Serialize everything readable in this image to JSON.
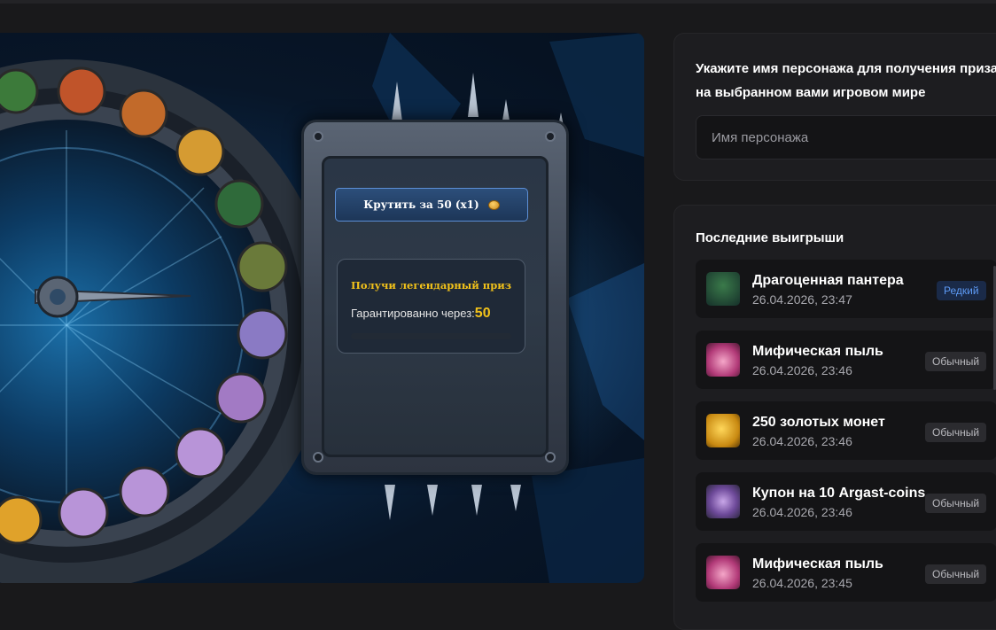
{
  "game": {
    "spin_button": "Крутить за 50 (x1)",
    "legend_title": "Получи легендарный приз",
    "guarantee_label": "Гарантированно через:",
    "guarantee_count": "50",
    "progress_fraction": 0
  },
  "name_form": {
    "title": "Укажите имя персонажа для получения приза на выбранном вами игровом мире",
    "placeholder": "Имя персонажа"
  },
  "wins": {
    "title": "Последние выигрыши",
    "items": [
      {
        "name": "Драгоценная пантера",
        "date": "26.04.2026, 23:47",
        "rarity": "Редкий",
        "icon": "panther-icon"
      },
      {
        "name": "Мифическая пыль",
        "date": "26.04.2026, 23:46",
        "rarity": "Обычный",
        "icon": "dust-icon"
      },
      {
        "name": "250 золотых монет",
        "date": "26.04.2026, 23:46",
        "rarity": "Обычный",
        "icon": "gold-coins-icon"
      },
      {
        "name": "Купон на 10 Argast-coins",
        "date": "26.04.2026, 23:46",
        "rarity": "Обычный",
        "icon": "coupon-icon"
      },
      {
        "name": "Мифическая пыль",
        "date": "26.04.2026, 23:45",
        "rarity": "Обычный",
        "icon": "dust-icon"
      }
    ]
  },
  "colors": {
    "accent_gold": "#f2c21a",
    "rare": "#5d9af5",
    "background": "#19191b"
  }
}
